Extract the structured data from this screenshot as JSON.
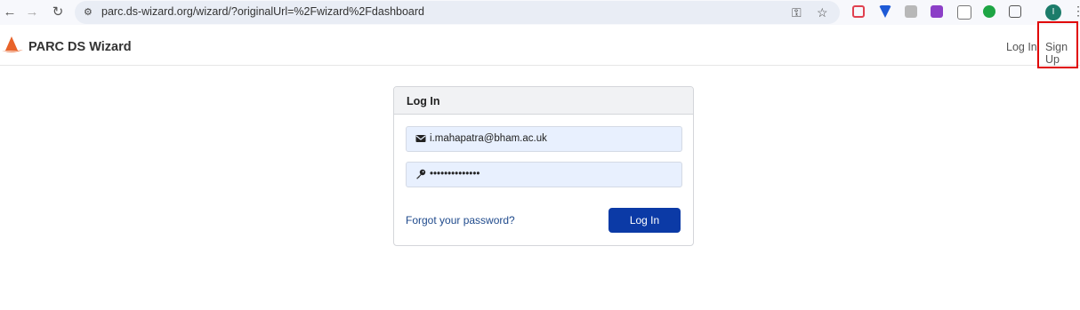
{
  "browser": {
    "url": "parc.ds-wizard.org/wizard/?originalUrl=%2Fwizard%2Fdashboard",
    "profile_initial": "I"
  },
  "header": {
    "brand": "PARC DS Wizard",
    "login_link": "Log In",
    "signup_link": "Sign Up"
  },
  "login": {
    "title": "Log In",
    "email_value": "i.mahapatra@bham.ac.uk",
    "password_value": "••••••••••••••",
    "forgot_link": "Forgot your password?",
    "submit_label": "Log In"
  },
  "colors": {
    "primary_button": "#0b3aa6",
    "link": "#1f4a8c",
    "highlight_box": "#e00000",
    "field_bg": "#e8f0fe"
  }
}
